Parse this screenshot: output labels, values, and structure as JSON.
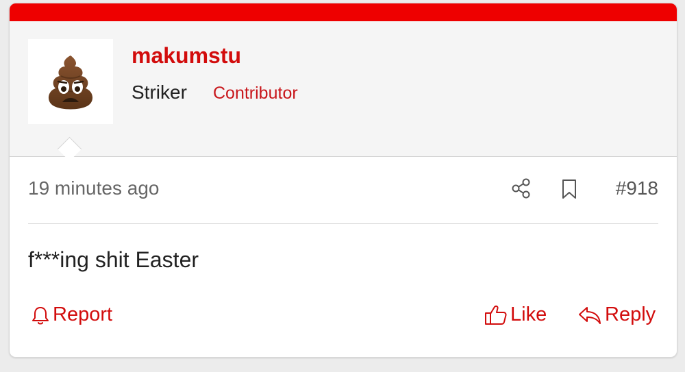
{
  "post": {
    "author": {
      "username": "makumstu",
      "rank": "Striker",
      "role": "Contributor",
      "avatar_icon": "pile-of-poo-emoji"
    },
    "timestamp": "19 minutes ago",
    "post_number": "#918",
    "body": "f***ing shit Easter",
    "actions": {
      "report_label": "Report",
      "like_label": "Like",
      "reply_label": "Reply"
    },
    "meta_icons": [
      "share-icon",
      "bookmark-icon"
    ]
  },
  "colors": {
    "accent": "#ee0000",
    "brand_text": "#d20c0c",
    "author_background": "#f5f5f5"
  }
}
